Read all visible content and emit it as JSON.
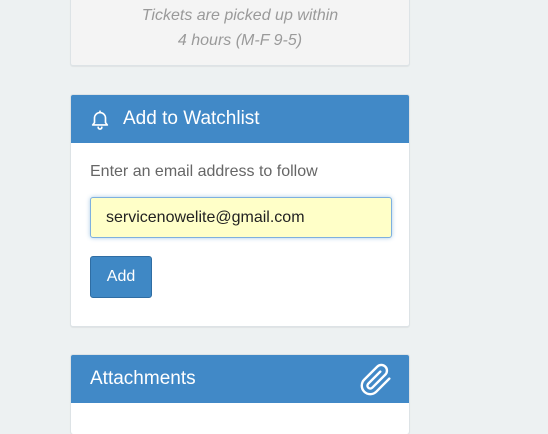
{
  "notice": {
    "line1": "Tickets are picked up within",
    "line2": "4 hours (M-F 9-5)"
  },
  "watchlist": {
    "title": "Add to Watchlist",
    "icon": "bell-icon",
    "label": "Enter an email address to follow",
    "email_value": "servicenowelite@gmail.com",
    "add_label": "Add"
  },
  "attachments": {
    "title": "Attachments",
    "icon": "paperclip-icon"
  },
  "colors": {
    "header_blue": "#4189c7",
    "input_bg": "#ffffc8",
    "page_bg": "#edf1f2"
  }
}
